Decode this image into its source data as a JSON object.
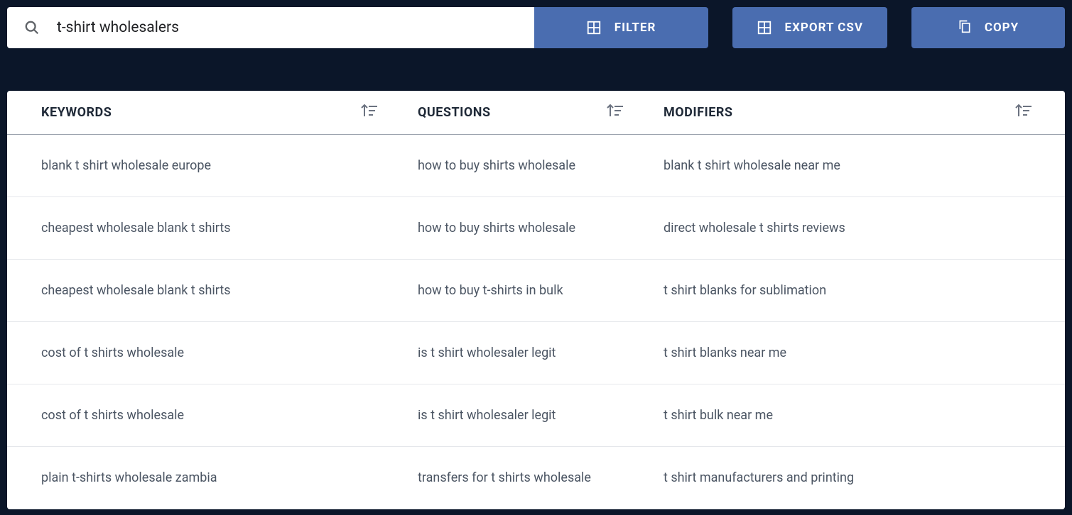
{
  "toolbar": {
    "search_value": "t-shirt wholesalers",
    "filter_label": "FILTER",
    "export_label": "EXPORT CSV",
    "copy_label": "COPY"
  },
  "columns": {
    "keywords_label": "KEYWORDS",
    "questions_label": "QUESTIONS",
    "modifiers_label": "MODIFIERS"
  },
  "rows": [
    {
      "keyword": "blank t shirt wholesale europe",
      "question": "how to buy shirts wholesale",
      "modifier": "blank t shirt wholesale near me"
    },
    {
      "keyword": "cheapest wholesale blank t shirts",
      "question": "how to buy shirts wholesale",
      "modifier": "direct wholesale t shirts reviews"
    },
    {
      "keyword": "cheapest wholesale blank t shirts",
      "question": "how to buy t-shirts in bulk",
      "modifier": "t shirt blanks for sublimation"
    },
    {
      "keyword": "cost of t shirts wholesale",
      "question": "is t shirt wholesaler legit",
      "modifier": "t shirt blanks near me"
    },
    {
      "keyword": "cost of t shirts wholesale",
      "question": "is t shirt wholesaler legit",
      "modifier": "t shirt bulk near me"
    },
    {
      "keyword": "plain t-shirts wholesale zambia",
      "question": "transfers for t shirts wholesale",
      "modifier": "t shirt manufacturers and printing"
    }
  ]
}
